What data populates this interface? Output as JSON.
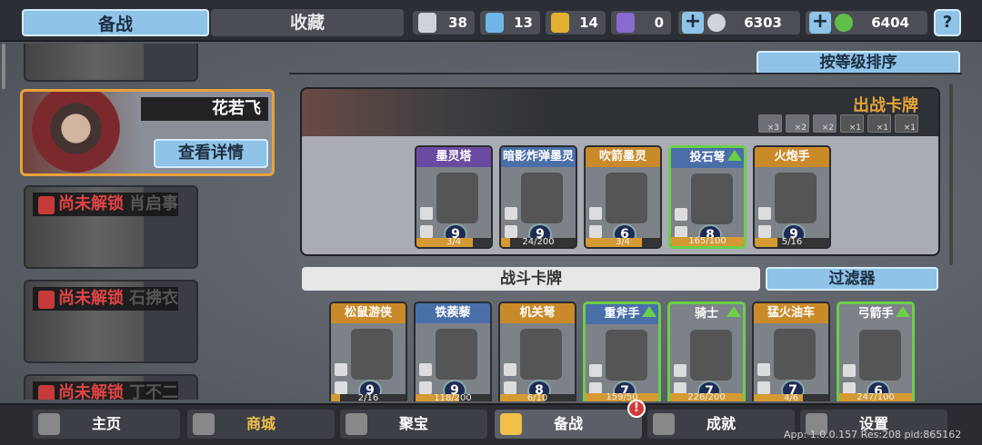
{
  "tabs": {
    "prep": "备战",
    "favorites": "收藏"
  },
  "resources": [
    {
      "name": "silver-shield",
      "value": "38",
      "color": "#cfd3d8"
    },
    {
      "name": "blue-shield",
      "value": "13",
      "color": "#6fb6e8"
    },
    {
      "name": "gold-shield",
      "value": "14",
      "color": "#e2b030"
    },
    {
      "name": "purple-shield",
      "value": "0",
      "color": "#8a6ad0"
    }
  ],
  "currency": [
    {
      "name": "silver-coin",
      "value": "6303",
      "color": "#d0d4d8"
    },
    {
      "name": "green-coin",
      "value": "6404",
      "color": "#5fbf4a"
    }
  ],
  "help_label": "?",
  "heroes": [
    {
      "name": "花若飞",
      "detail": "查看详情",
      "active": true
    },
    {
      "locked": "尚未解锁",
      "name": "肖启事"
    },
    {
      "locked": "尚未解锁",
      "name": "石拂衣"
    },
    {
      "locked": "尚未解锁",
      "name": "丁不二"
    }
  ],
  "sort_label": "按等级排序",
  "deck": {
    "title": "出战卡牌",
    "icons": [
      "×3",
      "×2",
      "×2",
      "×1",
      "×1",
      "×1"
    ],
    "cards": [
      {
        "name": "墨灵塔",
        "color": "purple",
        "level": "9",
        "progress": "3/4",
        "fill": 0.75,
        "up": false
      },
      {
        "name": "暗影炸弹墨灵",
        "color": "blue",
        "level": "9",
        "progress": "24/200",
        "fill": 0.12,
        "up": false
      },
      {
        "name": "吹箭墨灵",
        "color": "orange",
        "level": "6",
        "progress": "3/4",
        "fill": 0.75,
        "up": false
      },
      {
        "name": "投石弩",
        "color": "blue",
        "level": "8",
        "progress": "165/100",
        "fill": 1.0,
        "up": true
      },
      {
        "name": "火炮手",
        "color": "orange",
        "level": "9",
        "progress": "5/16",
        "fill": 0.31,
        "up": false
      }
    ]
  },
  "battle_cards_label": "战斗卡牌",
  "filter_label": "过滤器",
  "battle_cards": [
    {
      "name": "松鼠游侠",
      "color": "orange",
      "level": "9",
      "progress": "2/16",
      "fill": 0.12,
      "up": false
    },
    {
      "name": "铁蒺藜",
      "color": "blue",
      "level": "9",
      "progress": "118/200",
      "fill": 0.59,
      "up": false
    },
    {
      "name": "机关弩",
      "color": "orange",
      "level": "8",
      "progress": "6/10",
      "fill": 0.6,
      "up": false
    },
    {
      "name": "重斧手",
      "color": "blue",
      "level": "7",
      "progress": "159/50",
      "fill": 1.0,
      "up": true
    },
    {
      "name": "骑士",
      "color": "grey",
      "level": "7",
      "progress": "226/200",
      "fill": 1.0,
      "up": true
    },
    {
      "name": "猛火油车",
      "color": "orange",
      "level": "7",
      "progress": "4/6",
      "fill": 0.66,
      "up": false
    },
    {
      "name": "弓箭手",
      "color": "grey",
      "level": "6",
      "progress": "247/100",
      "fill": 1.0,
      "up": true
    }
  ],
  "nav": [
    {
      "label": "主页",
      "icon": "home-icon"
    },
    {
      "label": "商城",
      "icon": "shop-icon"
    },
    {
      "label": "聚宝",
      "icon": "treasure-icon"
    },
    {
      "label": "备战",
      "icon": "prep-icon",
      "badge": "!"
    },
    {
      "label": "成就",
      "icon": "achievement-icon"
    },
    {
      "label": "设置",
      "icon": "gear-icon"
    }
  ],
  "version": "App: 1.0.0.157 Res:208 pid:865162"
}
